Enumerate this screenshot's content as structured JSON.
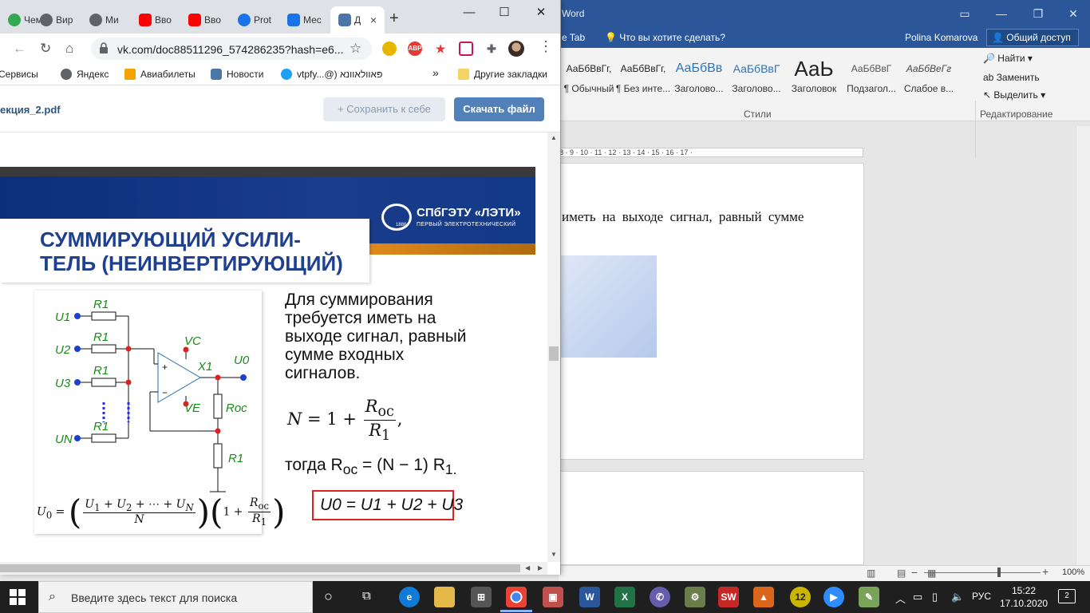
{
  "word": {
    "title": "Word",
    "tab_item": "e Tab",
    "tell_me": "Что вы хотите сделать?",
    "user": "Polina Komarova",
    "share": "Общий доступ",
    "styles": [
      {
        "sample": "АаБбВвГг,",
        "name": "¶ Обычный"
      },
      {
        "sample": "АаБбВвГг,",
        "name": "¶ Без инте..."
      },
      {
        "sample": "АаБбВв",
        "name": "Заголово..."
      },
      {
        "sample": "АаБбВвГ",
        "name": "Заголово..."
      },
      {
        "sample": "АаЬ",
        "name": "Заголовок"
      },
      {
        "sample": "АаБбВвГ",
        "name": "Подзагол..."
      },
      {
        "sample": "АаБбВеГг",
        "name": "Слабое в..."
      }
    ],
    "styles_group": "Стили",
    "edit_find": "Найти",
    "edit_replace": "Заменить",
    "edit_select": "Выделить",
    "edit_group": "Редактирование",
    "ruler": "8 · 9 · 10 · 11 · 12 · 13 · 14 · 15 · 16 · 17 ·",
    "doc_text": "иметь на выходе сигнал, равный сумме",
    "zoom": "100%"
  },
  "chrome": {
    "tabs": [
      {
        "label": "Чем",
        "color": "#34a853"
      },
      {
        "label": "Вир",
        "color": "#5f6368"
      },
      {
        "label": "Ми",
        "color": "#5f6368"
      },
      {
        "label": "Вво",
        "color": "#ff0000"
      },
      {
        "label": "Вво",
        "color": "#ff0000"
      },
      {
        "label": "Prot",
        "color": "#1a73e8"
      },
      {
        "label": "Мес",
        "color": "#1a73e8"
      },
      {
        "label": "Д",
        "color": "#4a76a8"
      }
    ],
    "tab_close": "×",
    "new_tab": "+",
    "url": "vk.com/doc88511296_574286235?hash=e6...",
    "bookmarks": [
      {
        "label": "Сервисы",
        "color": "#4285f4"
      },
      {
        "label": "Яндекс",
        "color": "#5f6368"
      },
      {
        "label": "Авиабилеты",
        "color": "#f4a300"
      },
      {
        "label": "Новости",
        "color": "#4a76a8"
      },
      {
        "label": "vtpfy...@) פּאוולאוונא",
        "color": "#1da1f2"
      }
    ],
    "bookmarks_more": "»",
    "other_bookmarks": "Другие закладки"
  },
  "viewer": {
    "doc_name": "екция_2.pdf",
    "save_label": "+  Сохранить к себе",
    "download_label": "Скачать файл"
  },
  "slide": {
    "title": "СУММИРУЮЩИЙ УСИЛИ-\nТЕЛЬ (НЕИНВЕРТИРУЮЩИЙ)",
    "logo_name": "СПбГЭТУ «ЛЭТИ»",
    "logo_sub": "ПЕРВЫЙ ЭЛЕКТРОТЕХНИЧЕСКИЙ",
    "logo_year": "1886",
    "body": "Для суммирования\nтребуется иметь на\nвыходе сигнал, равный\nсумме входных\nсигналов.",
    "togda": "тогда R",
    "togda_sub": "oc",
    "togda_rest": " = (N − 1) R",
    "togda_end": "1.",
    "result": "U0 = U1 + U2 + U3",
    "circuit": {
      "inputs": [
        "U1",
        "U2",
        "U3",
        "UN"
      ],
      "resistor": "R1",
      "output": "U0",
      "opamp": "X1",
      "vc": "VC",
      "ve": "VE",
      "roc": "Roc"
    }
  },
  "taskbar": {
    "search": "Введите здесь текст для поиска",
    "lang": "РУС",
    "time": "15:22",
    "date": "17.10.2020",
    "notifications": "2"
  }
}
